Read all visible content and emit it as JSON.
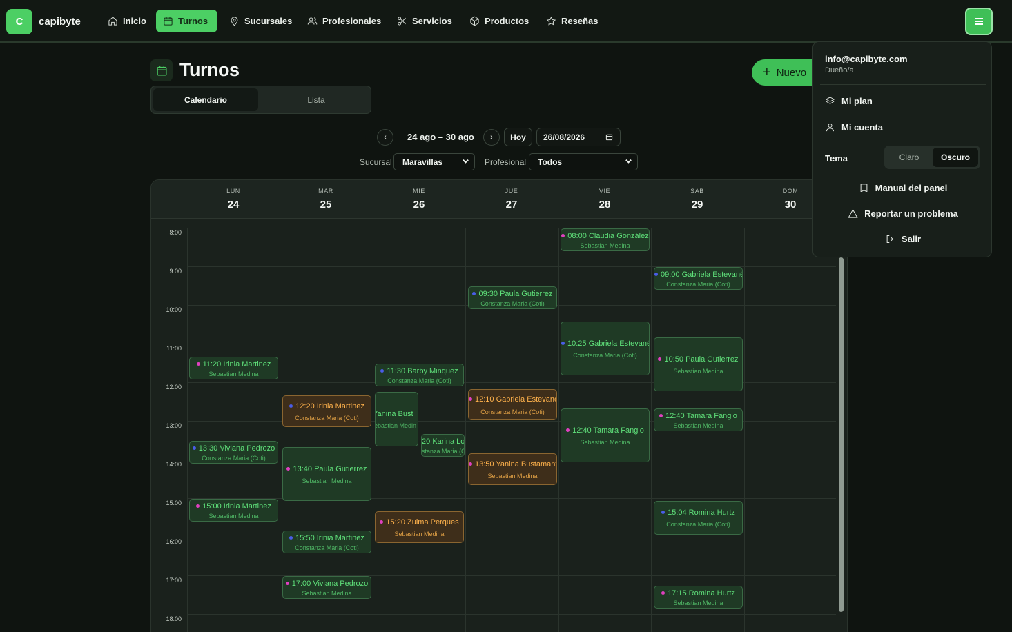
{
  "brand": {
    "logo_letter": "C",
    "name": "capibyte"
  },
  "nav": {
    "items": [
      {
        "label": "Inicio",
        "icon": "home-icon"
      },
      {
        "label": "Turnos",
        "icon": "calendar-icon",
        "active": true
      },
      {
        "label": "Sucursales",
        "icon": "map-pin-icon"
      },
      {
        "label": "Profesionales",
        "icon": "users-icon"
      },
      {
        "label": "Servicios",
        "icon": "scissors-icon"
      },
      {
        "label": "Productos",
        "icon": "box-icon"
      },
      {
        "label": "Reseñas",
        "icon": "star-icon"
      }
    ]
  },
  "page": {
    "title": "Turnos",
    "new_button": "Nuevo",
    "tabs": [
      "Calendario",
      "Lista"
    ],
    "active_tab": "Calendario"
  },
  "date_nav": {
    "prev": "‹",
    "next": "›",
    "range": "24 ago – 30 ago",
    "today": "Hoy",
    "date_value": "26/08/2026"
  },
  "filters": {
    "sucursal_label": "Sucursal",
    "sucursal_value": "Maravillas",
    "profesional_label": "Profesional",
    "profesional_value": "Todos"
  },
  "calendar": {
    "days": [
      {
        "dow": "LUN",
        "num": "24"
      },
      {
        "dow": "MAR",
        "num": "25"
      },
      {
        "dow": "MIÉ",
        "num": "26"
      },
      {
        "dow": "JUE",
        "num": "27"
      },
      {
        "dow": "VIE",
        "num": "28"
      },
      {
        "dow": "SÁB",
        "num": "29"
      },
      {
        "dow": "DOM",
        "num": "30"
      }
    ],
    "hours": [
      "8:00",
      "9:00",
      "10:00",
      "11:00",
      "12:00",
      "13:00",
      "14:00",
      "15:00",
      "16:00",
      "17:00",
      "18:00"
    ],
    "events": [
      {
        "time": "08:00",
        "client": "Claudia González",
        "pro": "Sebastian Medina"
      },
      {
        "time": "09:00",
        "client": "Gabriela Estevanéz",
        "pro": "Constanza Maria (Coti)"
      },
      {
        "time": "09:30",
        "client": "Paula Gutierrez",
        "pro": "Constanza Maria (Coti)"
      },
      {
        "time": "10:25",
        "client": "Gabriela Estevanéz",
        "pro": "Constanza Maria (Coti)"
      },
      {
        "time": "10:50",
        "client": "Paula Gutierrez",
        "pro": "Sebastian Medina"
      },
      {
        "time": "11:20",
        "client": "Irinia Martinez",
        "pro": "Sebastian Medina"
      },
      {
        "time": "11:30",
        "client": "Barby Minquez",
        "pro": "Constanza Maria (Coti)"
      },
      {
        "time": "12:20",
        "client": "Irinia Martinez",
        "pro": "Constanza Maria (Coti)"
      },
      {
        "time": "12:10",
        "client": "Gabriela Estevanéz",
        "pro": "Constanza Maria (Coti)"
      },
      {
        "time": "12:40",
        "client": "Tamara Fangio",
        "pro": "Sebastian Medina"
      },
      {
        "time": "12:40",
        "client": "Tamara Fangio",
        "pro": "Sebastian Medina"
      },
      {
        "time": "",
        "client": "Yanina Bust",
        "pro": "ebastian Medin"
      },
      {
        "time": "20",
        "client": "Karina Lo",
        "pro": "stanza Maria (C"
      },
      {
        "time": "13:30",
        "client": "Viviana Pedrozo",
        "pro": "Constanza Maria (Coti)"
      },
      {
        "time": "13:40",
        "client": "Paula Gutierrez",
        "pro": "Sebastian Medina"
      },
      {
        "time": "13:50",
        "client": "Yanina Bustamante",
        "pro": "Sebastian Medina"
      },
      {
        "time": "15:00",
        "client": "Irinia Martinez",
        "pro": "Sebastian Medina"
      },
      {
        "time": "15:04",
        "client": "Romina Hurtz",
        "pro": "Constanza Maria (Coti)"
      },
      {
        "time": "15:20",
        "client": "Zulma Perques",
        "pro": "Sebastian Medina"
      },
      {
        "time": "15:50",
        "client": "Irinia Martinez",
        "pro": "Constanza Maria (Coti)"
      },
      {
        "time": "17:00",
        "client": "Viviana Pedrozo",
        "pro": "Sebastian Medina"
      },
      {
        "time": "17:15",
        "client": "Romina Hurtz",
        "pro": "Sebastian Medina"
      }
    ]
  },
  "user_menu": {
    "email": "info@capibyte.com",
    "role": "Dueño/a",
    "my_plan": "Mi plan",
    "my_account": "Mi cuenta",
    "theme_label": "Tema",
    "theme_light": "Claro",
    "theme_dark": "Oscuro",
    "manual": "Manual del panel",
    "report": "Reportar un problema",
    "logout": "Salir"
  },
  "colors": {
    "accent": "#4ccf64",
    "event_green_bg": "#1f3a25",
    "event_amber_bg": "#3e2e1a",
    "dot_pink": "#e040c0",
    "dot_blue": "#4a5de8"
  }
}
